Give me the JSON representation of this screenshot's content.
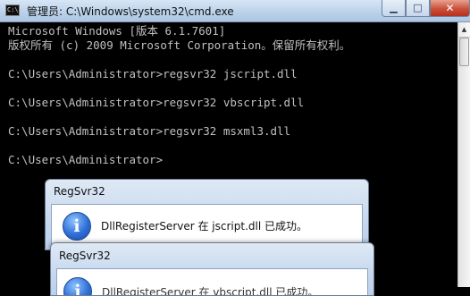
{
  "window": {
    "title": "管理员: C:\\Windows\\system32\\cmd.exe",
    "icon_text": "C:\\"
  },
  "console": {
    "lines": [
      "Microsoft Windows [版本 6.1.7601]",
      "版权所有 (c) 2009 Microsoft Corporation。保留所有权利。",
      "",
      "C:\\Users\\Administrator>regsvr32 jscript.dll",
      "",
      "C:\\Users\\Administrator>regsvr32 vbscript.dll",
      "",
      "C:\\Users\\Administrator>regsvr32 msxml3.dll",
      "",
      "C:\\Users\\Administrator>"
    ]
  },
  "dialogs": [
    {
      "title": "RegSvr32",
      "message": "DllRegisterServer 在 jscript.dll 已成功。",
      "icon": "info-icon"
    },
    {
      "title": "RegSvr32",
      "message": "DllRegisterServer 在 vbscript.dll 已成功。",
      "icon": "info-icon"
    }
  ],
  "colors": {
    "console_bg": "#000000",
    "console_text": "#c0c0c0",
    "close_button": "#c9503a"
  }
}
